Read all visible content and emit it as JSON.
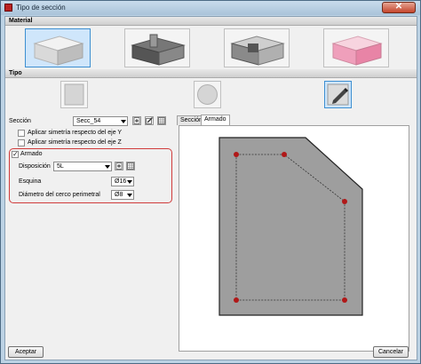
{
  "window": {
    "title": "Tipo de sección",
    "close_label": "✕"
  },
  "material": {
    "header": "Material",
    "options": [
      {
        "icon": "concrete-block-icon",
        "selected": true
      },
      {
        "icon": "steel-profile-icon",
        "selected": false
      },
      {
        "icon": "composite-steel-icon",
        "selected": false
      },
      {
        "icon": "pink-block-icon",
        "selected": false
      }
    ]
  },
  "tipo": {
    "header": "Tipo",
    "options": [
      {
        "icon": "rectangular-section-icon",
        "selected": false
      },
      {
        "icon": "circular-section-icon",
        "selected": false
      },
      {
        "icon": "custom-edit-section-icon",
        "selected": true
      }
    ]
  },
  "form": {
    "seccion_label": "Sección",
    "seccion_value": "Secc_54",
    "sym_y_label": "Aplicar simetría respecto del eje Y",
    "sym_z_label": "Aplicar simetría respecto del eje Z",
    "armado_label": "Armado",
    "armado_checked": true,
    "disposicion_label": "Disposición",
    "disposicion_value": "5L",
    "esquina_label": "Esquina",
    "esquina_value": "Ø16",
    "diametro_label": "Diámetro del cerco perimetral",
    "diametro_value": "Ø8"
  },
  "tabs": [
    {
      "label": "Sección",
      "active": false
    },
    {
      "label": "Armado",
      "active": true
    }
  ],
  "footer": {
    "accept_label": "Aceptar",
    "cancel_label": "Cancelar"
  },
  "colors": {
    "accent": "#3d8fd1",
    "highlight": "#d03b3b",
    "rebar": "#b01818",
    "section_fill": "#9e9e9e"
  }
}
